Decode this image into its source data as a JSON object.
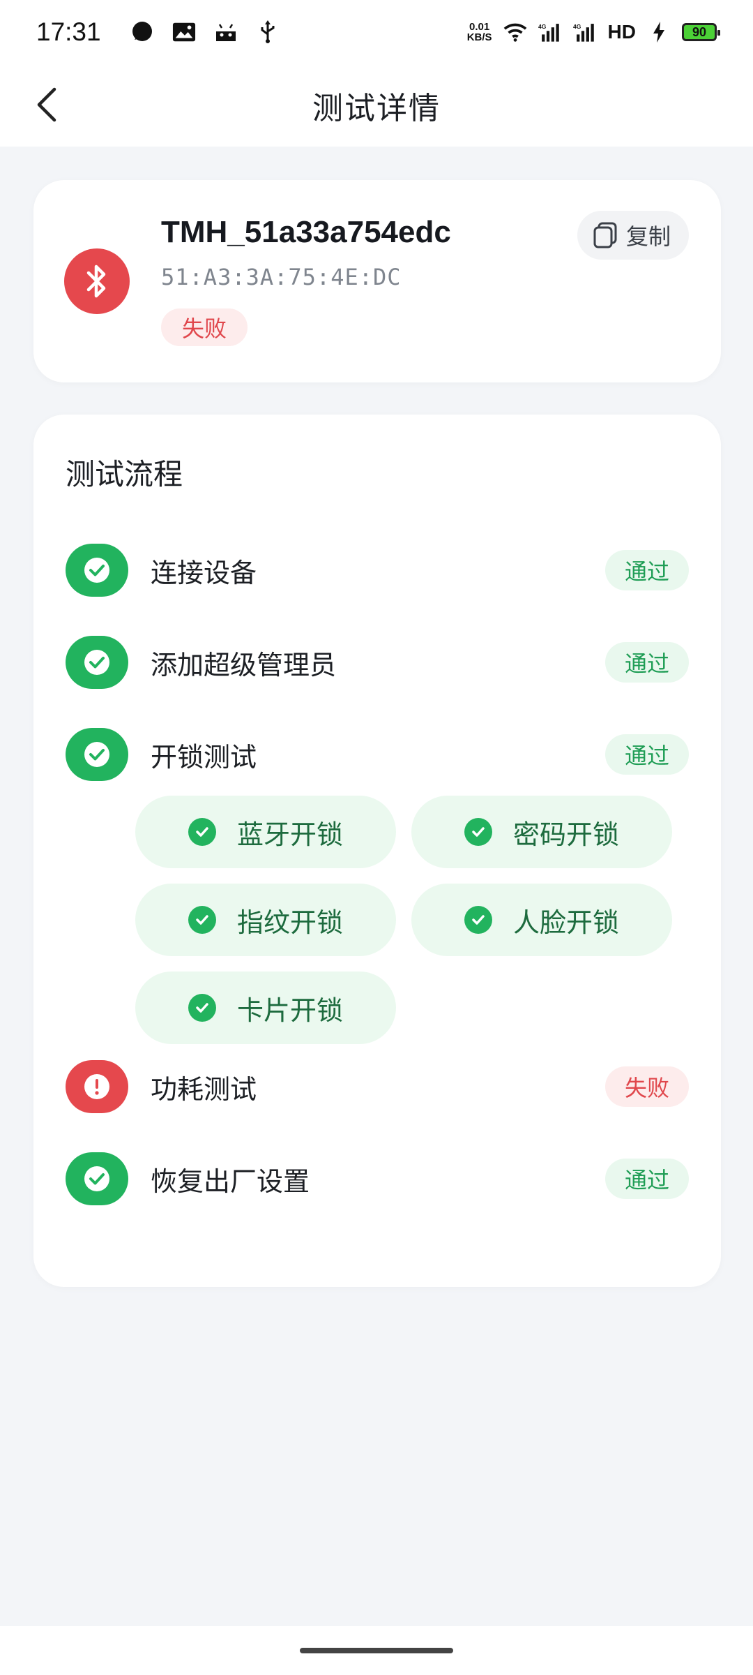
{
  "status_bar": {
    "time": "17:31",
    "net_speed_value": "0.01",
    "net_speed_unit": "KB/S",
    "hd_label": "HD",
    "battery": "90",
    "left_icons": [
      "chat-bubble-icon",
      "image-icon",
      "android-icon",
      "usb-icon"
    ],
    "right_icons": [
      "wifi-icon",
      "signal-4g-icon",
      "signal-4g-icon",
      "charging-icon"
    ]
  },
  "header": {
    "title": "测试详情",
    "back_icon": "chevron-left-icon"
  },
  "device": {
    "name": "TMH_51a33a754edc",
    "mac": "51:A3:3A:75:4E:DC",
    "status": "失败",
    "copy_label": "复制",
    "icon": "bluetooth-icon",
    "accent": "#e5484d"
  },
  "flow": {
    "title": "测试流程",
    "steps": [
      {
        "label": "连接设备",
        "status": "通过",
        "result": "pass"
      },
      {
        "label": "添加超级管理员",
        "status": "通过",
        "result": "pass"
      },
      {
        "label": "开锁测试",
        "status": "通过",
        "result": "pass"
      },
      {
        "label": "功耗测试",
        "status": "失败",
        "result": "fail"
      },
      {
        "label": "恢复出厂设置",
        "status": "通过",
        "result": "pass"
      }
    ],
    "unlock_methods": [
      "蓝牙开锁",
      "密码开锁",
      "指纹开锁",
      "人脸开锁",
      "卡片开锁"
    ]
  },
  "colors": {
    "pass": "#22b35e",
    "pass_bg": "#e9f8ee",
    "fail": "#e5484d",
    "fail_bg": "#fdecec",
    "page_bg": "#f3f5f8"
  }
}
